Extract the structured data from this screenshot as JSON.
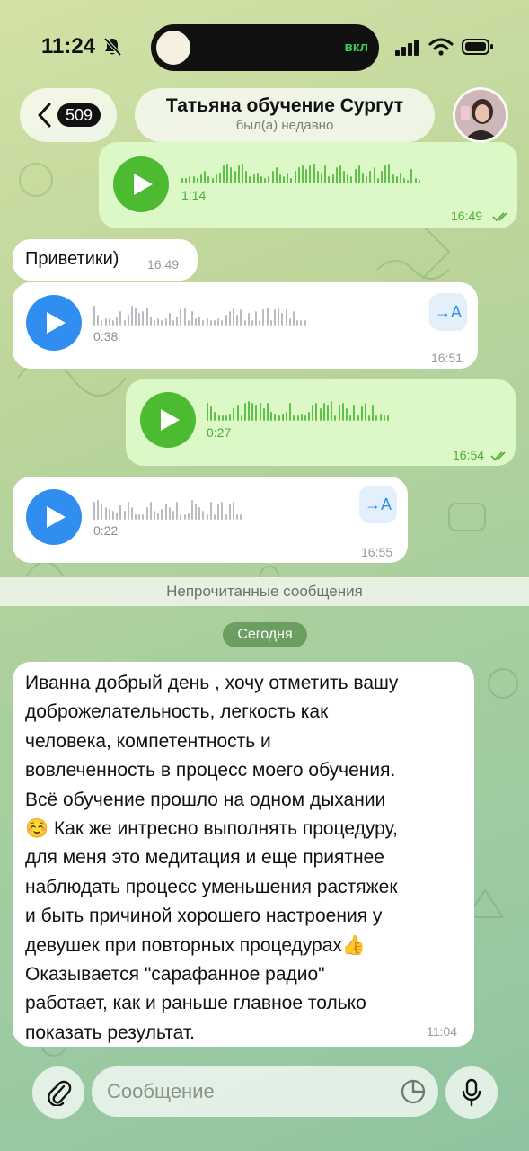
{
  "status_bar": {
    "time": "11:24",
    "island_label": "вкл"
  },
  "header": {
    "back_count": "509",
    "title": "Татьяна обучение Сургут",
    "subtitle": "был(а) недавно"
  },
  "messages": [
    {
      "kind": "voice",
      "direction": "out",
      "duration": "1:14",
      "time": "16:49"
    },
    {
      "kind": "text",
      "direction": "in",
      "text": "Приветики)",
      "time": "16:49"
    },
    {
      "kind": "voice",
      "direction": "in",
      "duration": "0:38",
      "time": "16:51",
      "transcribe_label": "→A"
    },
    {
      "kind": "voice",
      "direction": "out",
      "duration": "0:27",
      "time": "16:54"
    },
    {
      "kind": "voice",
      "direction": "in",
      "duration": "0:22",
      "time": "16:55",
      "transcribe_label": "→A"
    }
  ],
  "unread_label": "Непрочитанные сообщения",
  "date_label": "Сегодня",
  "long_message": {
    "lines": [
      "Иванна добрый день , хочу отметить вашу",
      "доброжелательность, легкость как",
      "человека, компетентность и",
      "вовлеченность в процесс моего обучения.",
      "Всё обучение прошло на одном дыхании",
      "☺️ Как же интресно выполнять процедуру,",
      "для меня это медитация и еще приятнее",
      "наблюдать процесс уменьшения растяжек",
      "и быть причиной хорошего настроения у",
      "девушек при повторных процедурах👍",
      "Оказывается \"сарафанное радио\"",
      "работает, как и раньше главное только",
      "показать результат."
    ],
    "time": "11:04"
  },
  "composer": {
    "placeholder": "Сообщение"
  },
  "colors": {
    "outgoing_bubble": "#dcf8c6",
    "incoming_bubble": "#ffffff",
    "outgoing_accent": "#4cbb32",
    "incoming_accent": "#2f8ef0"
  }
}
